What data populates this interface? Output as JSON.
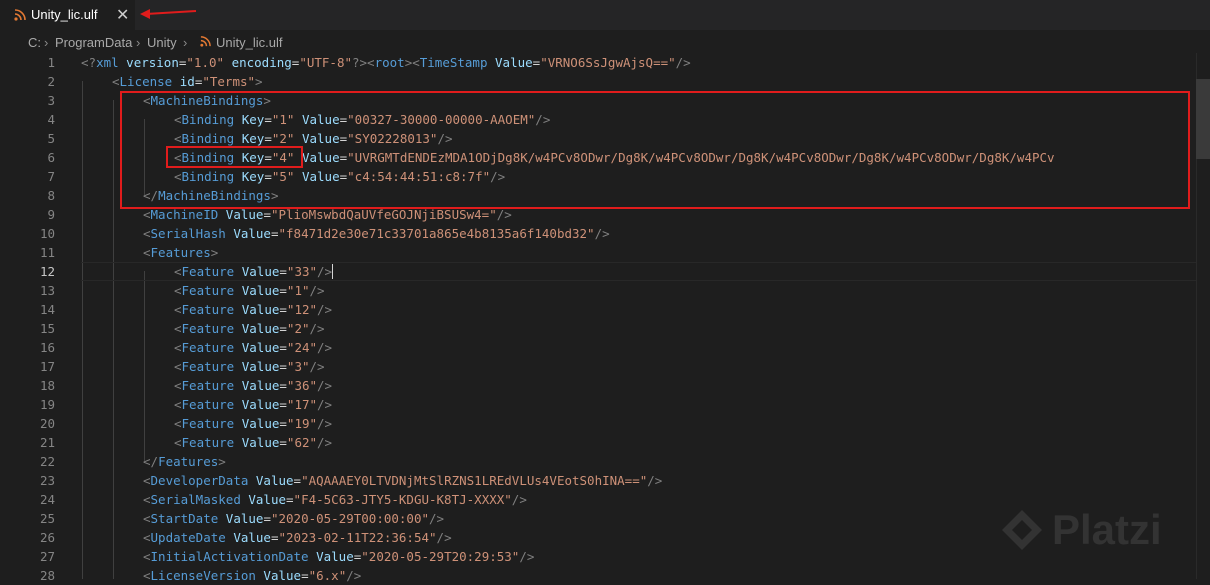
{
  "tab": {
    "label": "Unity_lic.ulf",
    "close": "✕"
  },
  "breadcrumb": {
    "parts": [
      "C:",
      "ProgramData",
      "Unity"
    ],
    "file": "Unity_lic.ulf",
    "separator": "›"
  },
  "lines": [
    {
      "n": "1"
    },
    {
      "n": "2"
    },
    {
      "n": "3"
    },
    {
      "n": "4"
    },
    {
      "n": "5"
    },
    {
      "n": "6"
    },
    {
      "n": "7"
    },
    {
      "n": "8"
    },
    {
      "n": "9"
    },
    {
      "n": "10"
    },
    {
      "n": "11"
    },
    {
      "n": "12"
    },
    {
      "n": "13"
    },
    {
      "n": "14"
    },
    {
      "n": "15"
    },
    {
      "n": "16"
    },
    {
      "n": "17"
    },
    {
      "n": "18"
    },
    {
      "n": "19"
    },
    {
      "n": "20"
    },
    {
      "n": "21"
    },
    {
      "n": "22"
    },
    {
      "n": "23"
    },
    {
      "n": "24"
    },
    {
      "n": "25"
    },
    {
      "n": "26"
    },
    {
      "n": "27"
    },
    {
      "n": "28"
    }
  ],
  "code": {
    "l1": {
      "decl": "<?xml version=\"1.0\" encoding=\"UTF-8\"?>",
      "xml": "xml",
      "version_attr": "version",
      "version_val": "\"1.0\"",
      "enc_attr": "encoding",
      "enc_val": "\"UTF-8\"",
      "root": "root",
      "timestamp": "TimeStamp",
      "value_attr": "Value",
      "timestamp_val": "\"VRNO6SsJgwAjsQ==\""
    },
    "l2": {
      "tag": "License",
      "attr": "id",
      "val": "\"Terms\""
    },
    "l3": {
      "tag": "MachineBindings"
    },
    "l4": {
      "tag": "Binding",
      "key_attr": "Key",
      "key_val": "\"1\"",
      "value_attr": "Value",
      "value_val": "\"00327-30000-00000-AAOEM\""
    },
    "l5": {
      "tag": "Binding",
      "key_attr": "Key",
      "key_val": "\"2\"",
      "value_attr": "Value",
      "value_val": "\"SY02228013\""
    },
    "l6": {
      "tag": "Binding",
      "key_attr": "Key",
      "key_val": "\"4\"",
      "value_attr": "Value",
      "value_val": "\"UVRGMTdENDEzMDA1ODjDg8K/w4PCv8ODwr/Dg8K/w4PCv8ODwr/Dg8K/w4PCv8ODwr/Dg8K/w4PCv8ODwr/Dg8K/w4PCv"
    },
    "l7": {
      "tag": "Binding",
      "key_attr": "Key",
      "key_val": "\"5\"",
      "value_attr": "Value",
      "value_val": "\"c4:54:44:51:c8:7f\""
    },
    "l8": {
      "tag": "MachineBindings"
    },
    "l9": {
      "tag": "MachineID",
      "attr": "Value",
      "val": "\"PlioMswbdQaUVfeGOJNjiBSUSw4=\""
    },
    "l10": {
      "tag": "SerialHash",
      "attr": "Value",
      "val": "\"f8471d2e30e71c33701a865e4b8135a6f140bd32\""
    },
    "l11": {
      "tag": "Features"
    },
    "features": [
      "\"33\"",
      "\"1\"",
      "\"12\"",
      "\"2\"",
      "\"24\"",
      "\"3\"",
      "\"36\"",
      "\"17\"",
      "\"19\"",
      "\"62\""
    ],
    "feature_tag": "Feature",
    "feature_attr": "Value",
    "l22": {
      "tag": "Features"
    },
    "l23": {
      "tag": "DeveloperData",
      "attr": "Value",
      "val": "\"AQAAAEY0LTVDNjMtSlRZNS1LREdVLUs4VEotS0hINA==\""
    },
    "l24": {
      "tag": "SerialMasked",
      "attr": "Value",
      "val": "\"F4-5C63-JTY5-KDGU-K8TJ-XXXX\""
    },
    "l25": {
      "tag": "StartDate",
      "attr": "Value",
      "val": "\"2020-05-29T00:00:00\""
    },
    "l26": {
      "tag": "UpdateDate",
      "attr": "Value",
      "val": "\"2023-02-11T22:36:54\""
    },
    "l27": {
      "tag": "InitialActivationDate",
      "attr": "Value",
      "val": "\"2020-05-29T20:29:53\""
    },
    "l28": {
      "tag": "LicenseVersion",
      "attr": "Value",
      "val": "\"6.x\""
    }
  },
  "watermark": {
    "text": "Platzi"
  },
  "colors": {
    "background": "#1e1e1e",
    "tag": "#569cd6",
    "attribute": "#9cdcfe",
    "string": "#ce9178",
    "punct": "#808080",
    "highlight": "#e01c1c"
  }
}
